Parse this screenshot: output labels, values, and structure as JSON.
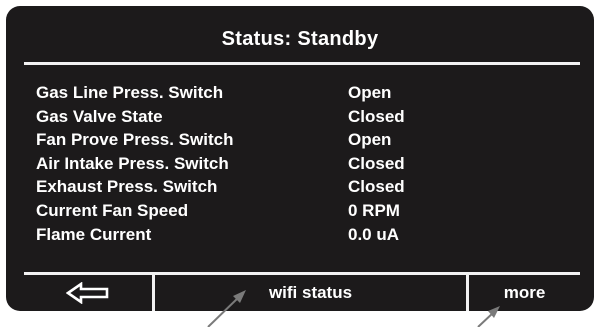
{
  "header": {
    "title": "Status: Standby"
  },
  "status_rows": [
    {
      "label": "Gas Line Press. Switch",
      "value": "Open"
    },
    {
      "label": "Gas Valve State",
      "value": "Closed"
    },
    {
      "label": "Fan Prove Press. Switch",
      "value": "Open"
    },
    {
      "label": "Air Intake Press. Switch",
      "value": "Closed"
    },
    {
      "label": "Exhaust Press. Switch",
      "value": "Closed"
    },
    {
      "label": "Current Fan Speed",
      "value": "0 RPM"
    },
    {
      "label": "Flame Current",
      "value": "0.0 uA"
    }
  ],
  "footer": {
    "back_icon": "back-arrow-icon",
    "wifi_label": "wifi status",
    "more_label": "more"
  },
  "colors": {
    "screen_bg": "#1c1a1b",
    "text": "#ffffff",
    "rule": "#f2f2f2",
    "callout_arrow": "#7a7a7a"
  }
}
